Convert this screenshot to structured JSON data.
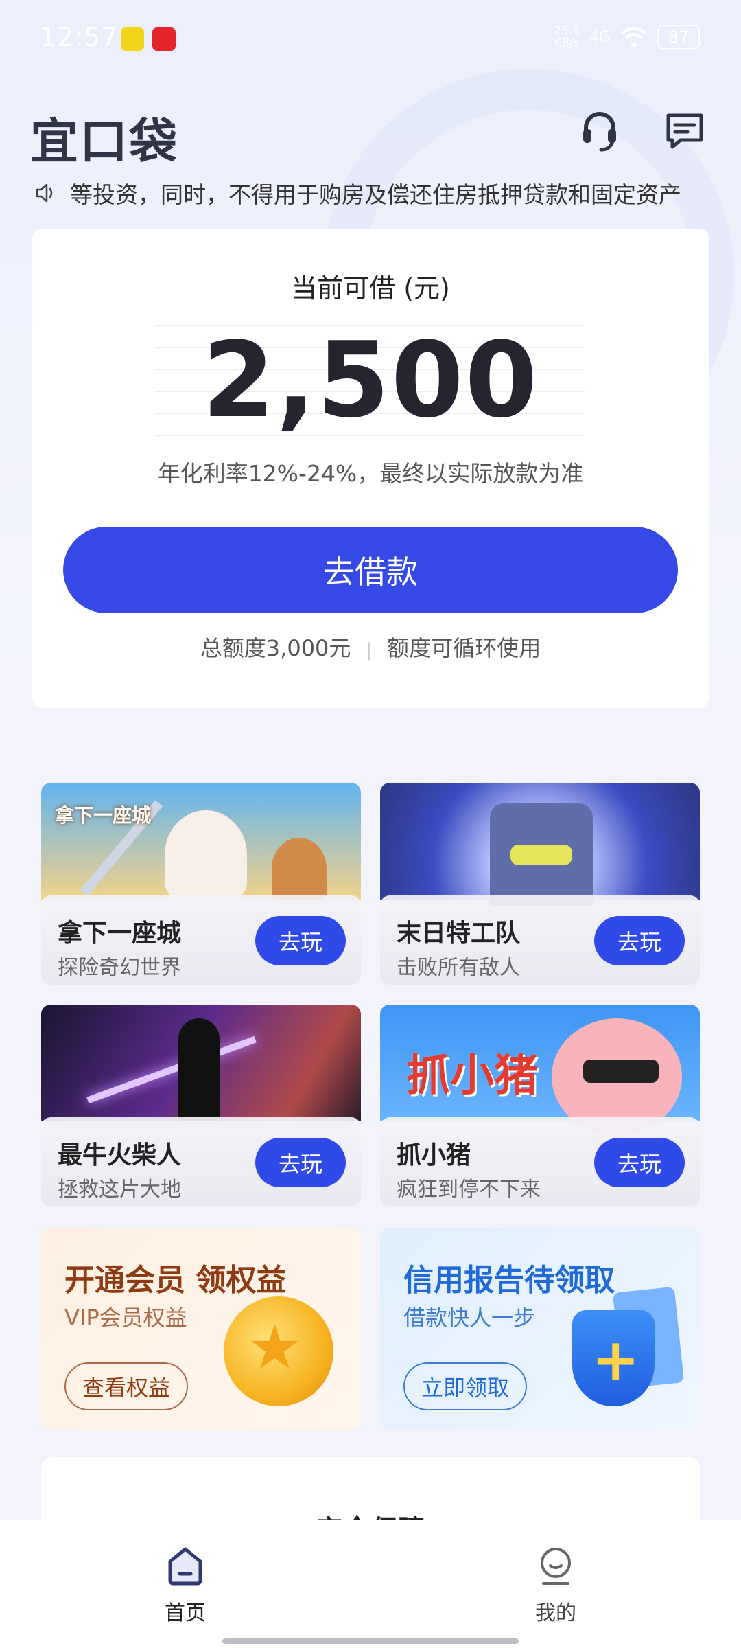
{
  "status_bar": {
    "time": "12:57",
    "net_speed_top": "25.9",
    "net_speed_unit": "KB/s",
    "signal": "4G",
    "battery": "87"
  },
  "header": {
    "logo": "宜口袋",
    "headset_icon": "headset-icon",
    "message_icon": "message-icon"
  },
  "notice": {
    "icon": "speaker-icon",
    "text": "等投资，同时，不得用于购房及偿还住房抵押贷款和固定资产"
  },
  "loan_card": {
    "label": "当前可借 (元)",
    "amount": "2,500",
    "rate_text": "年化利率12%-24%，最终以实际放款为准",
    "button_label": "去借款",
    "total_quota": "总额度3,000元",
    "separator": "|",
    "recurring_note": "额度可循环使用",
    "button_color": "#3549e6"
  },
  "games": [
    {
      "title": "拿下一座城",
      "subtitle": "探险奇幻世界",
      "button": "去玩",
      "art_text": "拿下一座城"
    },
    {
      "title": "末日特工队",
      "subtitle": "击败所有敌人",
      "button": "去玩"
    },
    {
      "title": "最牛火柴人",
      "subtitle": "拯救这片大地",
      "button": "去玩"
    },
    {
      "title": "抓小猪",
      "subtitle": "疯狂到停不下来",
      "button": "去玩",
      "art_text": "抓小猪"
    }
  ],
  "promos": {
    "vip": {
      "title": "开通会员 领权益",
      "subtitle": "VIP会员权益",
      "button": "查看权益"
    },
    "credit": {
      "title": "信用报告待领取",
      "subtitle": "借款快人一步",
      "button": "立即领取"
    }
  },
  "safety": {
    "title": "安全保障"
  },
  "tabbar": {
    "home": "首页",
    "mine": "我的",
    "active_color": "#2f3970"
  }
}
